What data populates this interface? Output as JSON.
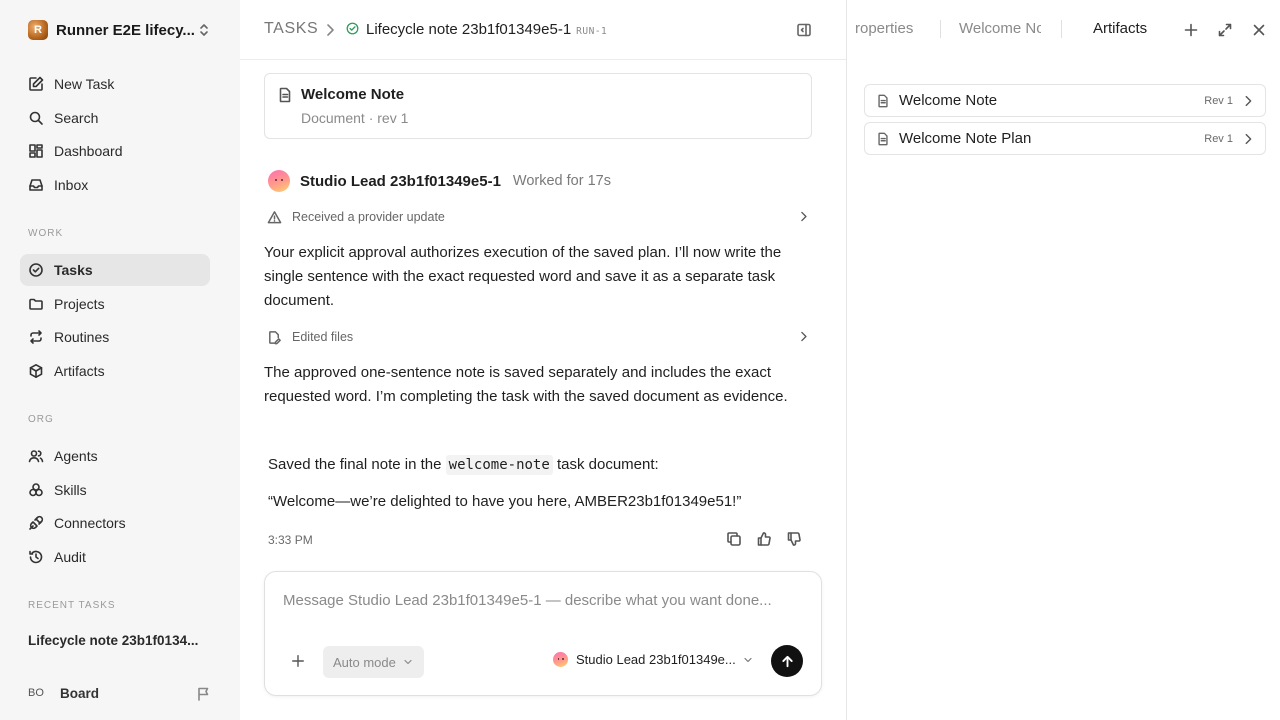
{
  "workspace": {
    "logo_letter": "R",
    "name": "Runner E2E lifecy..."
  },
  "sidebar": {
    "top_items": [
      {
        "label": "New Task",
        "icon": "edit-icon"
      },
      {
        "label": "Search",
        "icon": "search-icon"
      },
      {
        "label": "Dashboard",
        "icon": "dashboard-icon"
      },
      {
        "label": "Inbox",
        "icon": "inbox-icon"
      }
    ],
    "work_label": "WORK",
    "work_items": [
      {
        "label": "Tasks",
        "icon": "check-circle-icon",
        "active": true
      },
      {
        "label": "Projects",
        "icon": "folder-icon"
      },
      {
        "label": "Routines",
        "icon": "repeat-icon"
      },
      {
        "label": "Artifacts",
        "icon": "box-icon"
      }
    ],
    "org_label": "ORG",
    "org_items": [
      {
        "label": "Agents",
        "icon": "users-icon"
      },
      {
        "label": "Skills",
        "icon": "skills-icon"
      },
      {
        "label": "Connectors",
        "icon": "plug-icon"
      },
      {
        "label": "Audit",
        "icon": "history-icon"
      }
    ],
    "recent_label": "RECENT TASKS",
    "recent_task": "Lifecycle note 23b1f0134...",
    "board": {
      "initials": "BO",
      "name": "Board"
    }
  },
  "header": {
    "root": "TASKS",
    "title": "Lifecycle note 23b1f01349e5-1",
    "run_tag": "RUN-1"
  },
  "doc_card": {
    "title": "Welcome Note",
    "subtitle": "Document · rev 1"
  },
  "agent": {
    "name": "Studio Lead 23b1f01349e5-1",
    "worked": "Worked for 17s"
  },
  "activity": {
    "provider_update": "Received a provider update",
    "edited_files": "Edited files"
  },
  "messages": {
    "p1": "Your explicit approval authorizes execution of the saved plan. I’ll now write the single sentence with the exact requested word and save it as a separate task document.",
    "p2": "The approved one-sentence note is saved separately and includes the exact requested word. I’m completing the task with the saved document as evidence.",
    "saved_prefix": "Saved the final note in the",
    "saved_code": "welcome-note",
    "saved_suffix": "task document:",
    "quote": "“Welcome—we’re delighted to have you here, AMBER23b1f01349e51!”",
    "time": "3:33 PM"
  },
  "composer": {
    "placeholder": "Message Studio Lead 23b1f01349e5-1 — describe what you want done...",
    "mode": "Auto mode",
    "agent_select": "Studio Lead 23b1f01349e..."
  },
  "right_panel": {
    "tabs": [
      "roperties",
      "Welcome No",
      "Artifacts"
    ],
    "active_tab": "Artifacts",
    "artifacts": [
      {
        "name": "Welcome Note",
        "rev": "Rev 1"
      },
      {
        "name": "Welcome Note Plan",
        "rev": "Rev 1"
      }
    ]
  },
  "colors": {
    "accent": "#111111",
    "status_green": "#2f9e5b",
    "sidebar_bg": "#f6f6f6",
    "active_nav_bg": "#e6e6e6"
  }
}
